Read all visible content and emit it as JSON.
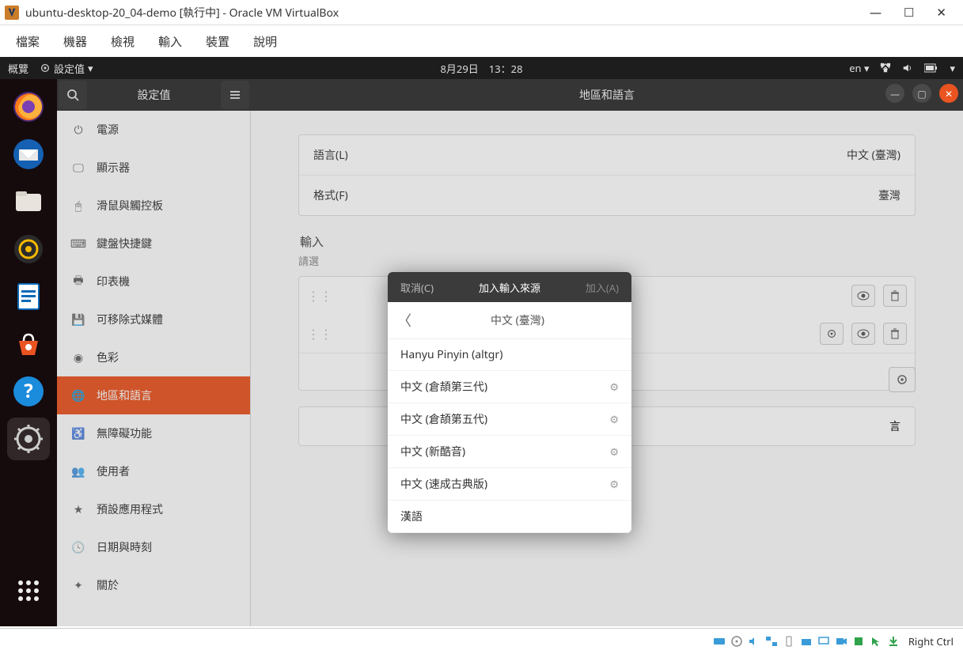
{
  "vb": {
    "title": "ubuntu-desktop-20_04-demo [執行中] - Oracle VM VirtualBox",
    "menu": {
      "file": "檔案",
      "machine": "機器",
      "view": "檢視",
      "input": "輸入",
      "devices": "裝置",
      "help": "說明"
    },
    "host_key": "Right Ctrl"
  },
  "topbar": {
    "overview": "概覽",
    "settings_drop": "設定值",
    "clock": "8月29日　13：28",
    "lang": "en"
  },
  "settings": {
    "sidebar_title": "設定值",
    "window_title": "地區和語言",
    "sidebar": {
      "power": "電源",
      "displays": "顯示器",
      "mouse": "滑鼠與觸控板",
      "keyboard": "鍵盤快捷鍵",
      "printers": "印表機",
      "removable": "可移除式媒體",
      "color": "色彩",
      "region": "地區和語言",
      "accessibility": "無障礙功能",
      "users": "使用者",
      "default_apps": "預設應用程式",
      "datetime": "日期與時刻",
      "about": "關於"
    },
    "content": {
      "language_label": "語言(L)",
      "language_value": "中文 (臺灣)",
      "format_label": "格式(F)",
      "format_value": "臺灣",
      "input_sources_label": "輸入",
      "input_hint": "請選",
      "manage_label": "言"
    }
  },
  "popover": {
    "cancel": "取消(C)",
    "title": "加入輸入來源",
    "add": "加入(A)",
    "nav_label": "中文 (臺灣)",
    "items": [
      {
        "label": "Hanyu Pinyin (altgr)",
        "gear": false
      },
      {
        "label": "中文 (倉頡第三代)",
        "gear": true
      },
      {
        "label": "中文 (倉頡第五代)",
        "gear": true
      },
      {
        "label": "中文 (新酷音)",
        "gear": true
      },
      {
        "label": "中文 (速成古典版)",
        "gear": true
      },
      {
        "label": "漢語",
        "gear": false
      }
    ]
  }
}
